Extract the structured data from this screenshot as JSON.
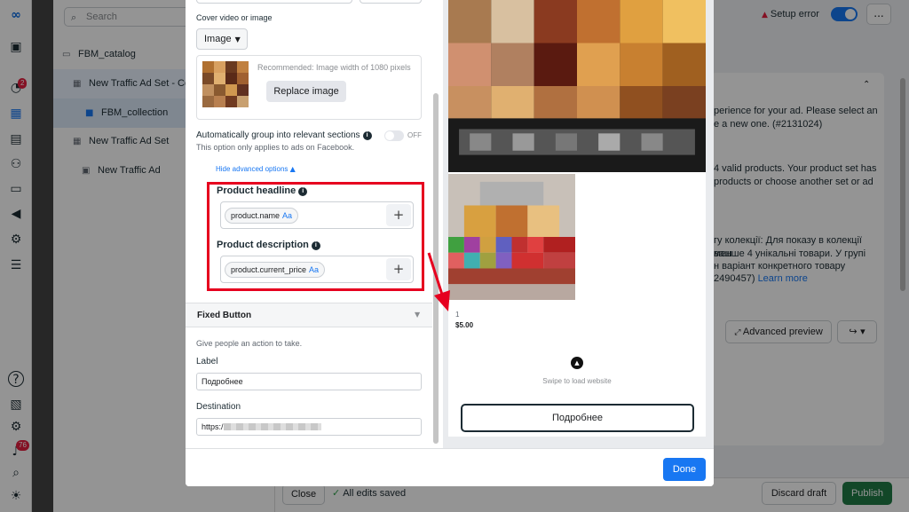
{
  "rail": {
    "notif_badge": "2",
    "alerts_badge": "76"
  },
  "search": {
    "placeholder": "Search"
  },
  "tree": {
    "catalog": "FBM_catalog",
    "adset_1": "New Traffic Ad Set - Cop",
    "collection": "FBM_collection",
    "adset_2": "New Traffic Ad Set",
    "ad": "New Traffic Ad"
  },
  "topbar": {
    "setup_error": "Setup error",
    "more": "..."
  },
  "right_panel": {
    "msg1": "perience for your ad. Please select an",
    "msg1b": "e a new one. (#2131024)",
    "msg2": "4 valid products. Your product set has",
    "msg2b": "products or choose another set or ad",
    "msg3a": "гу колекції: Для показу в колекції ваш",
    "msg3b": "менше 4 унікальні товари. У групі",
    "msg3c": "н варіант конкретного товару",
    "msg3d": "2490457)",
    "learn_more": "Learn more",
    "advanced_preview": "Advanced preview"
  },
  "bottombar": {
    "close": "Close",
    "saved": "All edits saved",
    "discard": "Discard draft",
    "publish": "Publish"
  },
  "form": {
    "cover_label": "Cover video or image",
    "media_type": "Image",
    "recommended": "Recommended: Image width of 1080 pixels",
    "replace_image": "Replace image",
    "auto_group": "Automatically group into relevant sections",
    "auto_group_note": "This option only applies to ads on Facebook.",
    "auto_group_state": "OFF",
    "hide_advanced": "Hide advanced options",
    "headline_label": "Product headline",
    "headline_token": "product.name",
    "description_label": "Product description",
    "description_token": "product.current_price",
    "token_suffix": "Aa",
    "fixed_button_title": "Fixed Button",
    "fixed_button_sub": "Give people an action to take.",
    "label_title": "Label",
    "label_value": "Подробнее",
    "destination_title": "Destination",
    "destination_value": "https:/"
  },
  "preview": {
    "index": "1",
    "price": "$5.00",
    "swipe": "Swipe to load website",
    "cta": "Подробнее"
  },
  "footer": {
    "done": "Done"
  }
}
